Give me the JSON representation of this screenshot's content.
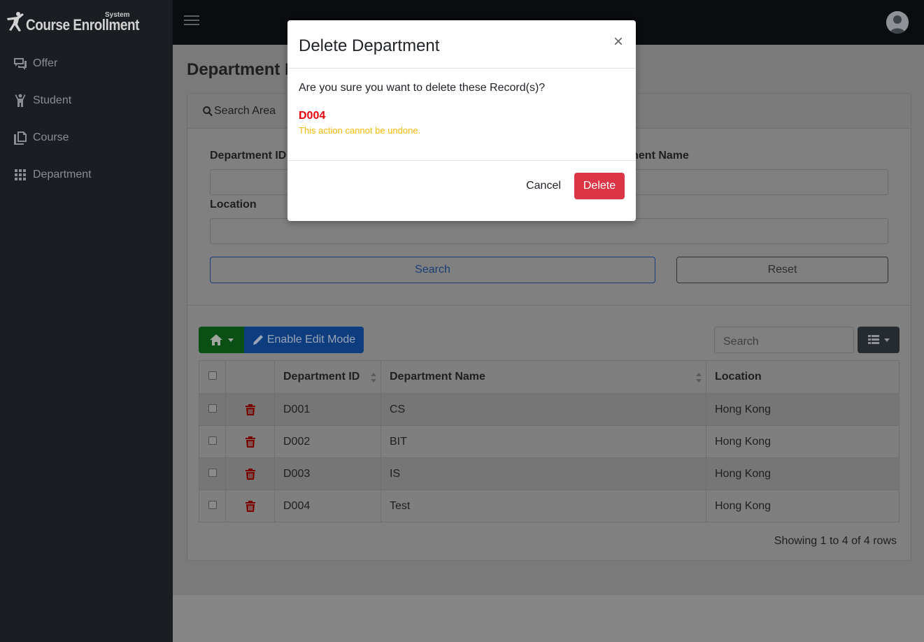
{
  "brand": {
    "title": "Course Enrollment",
    "subtitle": "System"
  },
  "sidebar": {
    "items": [
      {
        "label": "Offer",
        "icon": "offer-icon"
      },
      {
        "label": "Student",
        "icon": "student-icon"
      },
      {
        "label": "Course",
        "icon": "course-icon"
      },
      {
        "label": "Department",
        "icon": "grid-icon"
      }
    ]
  },
  "page": {
    "title": "Department List"
  },
  "search_area": {
    "header": "Search Area",
    "dept_id_label": "Department ID",
    "dept_name_label": "Department Name",
    "location_label": "Location",
    "search_button": "Search",
    "reset_button": "Reset"
  },
  "toolbar": {
    "edit_mode_label": "Enable Edit Mode",
    "search_placeholder": "Search"
  },
  "table": {
    "headers": [
      "Department ID",
      "Department Name",
      "Location"
    ],
    "rows": [
      {
        "id": "D001",
        "name": "CS",
        "location": "Hong Kong"
      },
      {
        "id": "D002",
        "name": "BIT",
        "location": "Hong Kong"
      },
      {
        "id": "D003",
        "name": "IS",
        "location": "Hong Kong"
      },
      {
        "id": "D004",
        "name": "Test",
        "location": "Hong Kong"
      }
    ],
    "footer": "Showing 1 to 4 of 4 rows"
  },
  "modal": {
    "title": "Delete Department",
    "close": "×",
    "message": "Are you sure you want to delete these Record(s)?",
    "record": "D004",
    "warning": "This action cannot be undone.",
    "cancel_label": "Cancel",
    "delete_label": "Delete"
  },
  "colors": {
    "danger": "#dc3545",
    "warning": "#f5b800",
    "record": "#e8000b"
  }
}
